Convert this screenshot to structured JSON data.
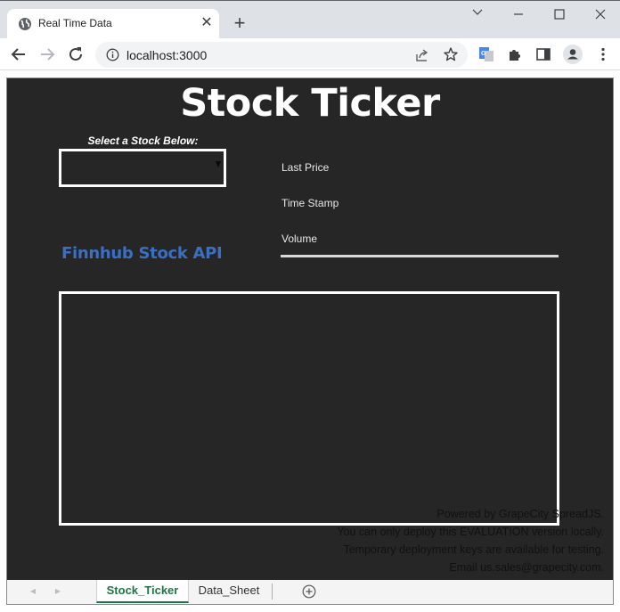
{
  "browser": {
    "tab_title": "Real Time Data",
    "tab_icon": "globe-icon",
    "url": "localhost:3000",
    "window_controls": [
      "tab-search",
      "minimize",
      "maximize",
      "close"
    ],
    "toolbar_icons": [
      "share-icon",
      "bookmark-star-icon",
      "google-translate-icon",
      "extensions-icon",
      "side-panel-icon",
      "profile-icon",
      "more-menu-icon"
    ]
  },
  "sheet": {
    "title": "Stock Ticker",
    "select_label": "Select a Stock Below:",
    "selected_stock": "",
    "info_rows": [
      {
        "label": "Last Price",
        "value": ""
      },
      {
        "label": "Time Stamp",
        "value": ""
      },
      {
        "label": "Volume",
        "value": ""
      }
    ],
    "api_label": "Finnhub Stock API",
    "accent_color": "#3a6fc4",
    "watermark": [
      "Powered by GrapeCity SpreadJS.",
      "You can only deploy this EVALUATION version locally.",
      "Temporary deployment keys are available for testing.",
      "Email us.sales@grapecity.com."
    ]
  },
  "sheet_tabs": {
    "tabs": [
      {
        "label": "Stock_Ticker",
        "active": true
      },
      {
        "label": "Data_Sheet",
        "active": false
      }
    ],
    "active_color": "#217346"
  }
}
